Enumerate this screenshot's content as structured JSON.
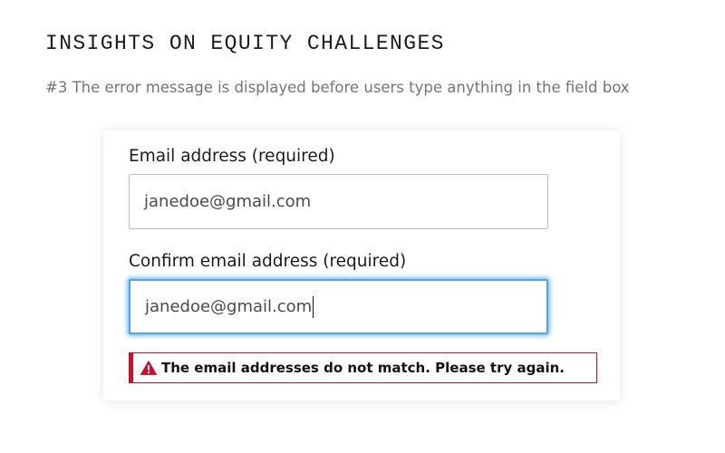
{
  "page": {
    "title": "INSIGHTS ON EQUITY CHALLENGES",
    "subtitle": "#3 The error message is displayed before users type anything in the field box"
  },
  "form": {
    "email": {
      "label": "Email address (required)",
      "value": "janedoe@gmail.com"
    },
    "confirm_email": {
      "label": "Confirm email address (required)",
      "value": "janedoe@gmail.com",
      "focused": true
    },
    "error": {
      "icon": "warning-triangle-icon",
      "message": "The email addresses do not match. Please try again."
    }
  },
  "colors": {
    "error": "#c8102e",
    "focus_ring": "#4aa6ee"
  }
}
